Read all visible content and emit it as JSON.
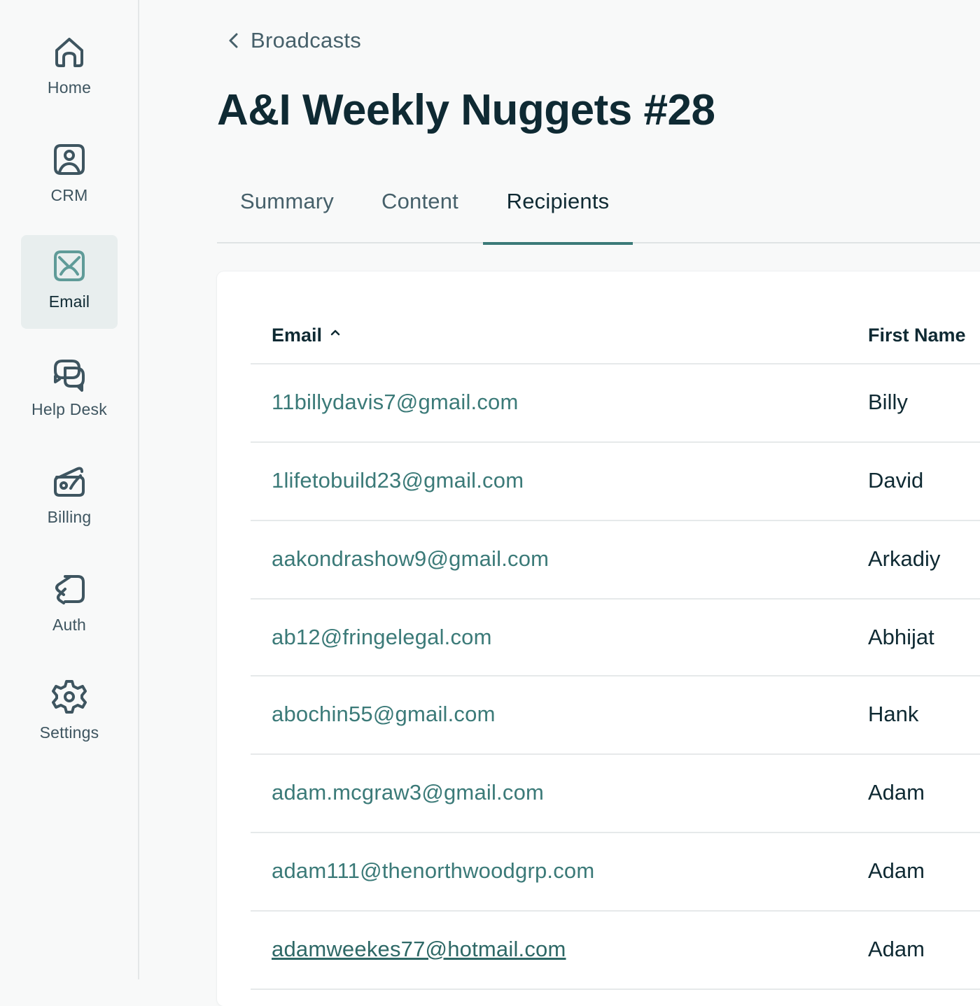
{
  "sidebar": {
    "items": [
      {
        "label": "Home",
        "icon": "home-icon",
        "active": false
      },
      {
        "label": "CRM",
        "icon": "crm-icon",
        "active": false
      },
      {
        "label": "Email",
        "icon": "email-icon",
        "active": true
      },
      {
        "label": "Help Desk",
        "icon": "help-desk-icon",
        "active": false
      },
      {
        "label": "Billing",
        "icon": "billing-icon",
        "active": false
      },
      {
        "label": "Auth",
        "icon": "auth-icon",
        "active": false
      },
      {
        "label": "Settings",
        "icon": "gear-icon",
        "active": false
      }
    ]
  },
  "breadcrumb": {
    "label": "Broadcasts",
    "icon": "chevron-left-icon"
  },
  "page": {
    "title": "A&I Weekly Nuggets #28"
  },
  "tabs": [
    {
      "label": "Summary",
      "active": false
    },
    {
      "label": "Content",
      "active": false
    },
    {
      "label": "Recipients",
      "active": true
    }
  ],
  "table": {
    "columns": [
      {
        "label": "Email",
        "sorted": "ascending",
        "sort_icon": "chevron-up-icon"
      },
      {
        "label": "First Name"
      }
    ],
    "rows": [
      {
        "email": "11billydavis7@gmail.com",
        "first_name": "Billy"
      },
      {
        "email": "1lifetobuild23@gmail.com",
        "first_name": "David"
      },
      {
        "email": "aakondrashow9@gmail.com",
        "first_name": "Arkadiy"
      },
      {
        "email": "ab12@fringelegal.com",
        "first_name": "Abhijat"
      },
      {
        "email": "abochin55@gmail.com",
        "first_name": "Hank"
      },
      {
        "email": "adam.mcgraw3@gmail.com",
        "first_name": "Adam"
      },
      {
        "email": "adam111@thenorthwoodgrp.com",
        "first_name": "Adam"
      },
      {
        "email": "adamweekes77@hotmail.com",
        "first_name": "Adam"
      }
    ]
  },
  "colors": {
    "accent": "#3b7a78",
    "text_primary": "#0f2a33",
    "text_secondary": "#46606a",
    "active_nav_bg": "#e8eeee"
  }
}
